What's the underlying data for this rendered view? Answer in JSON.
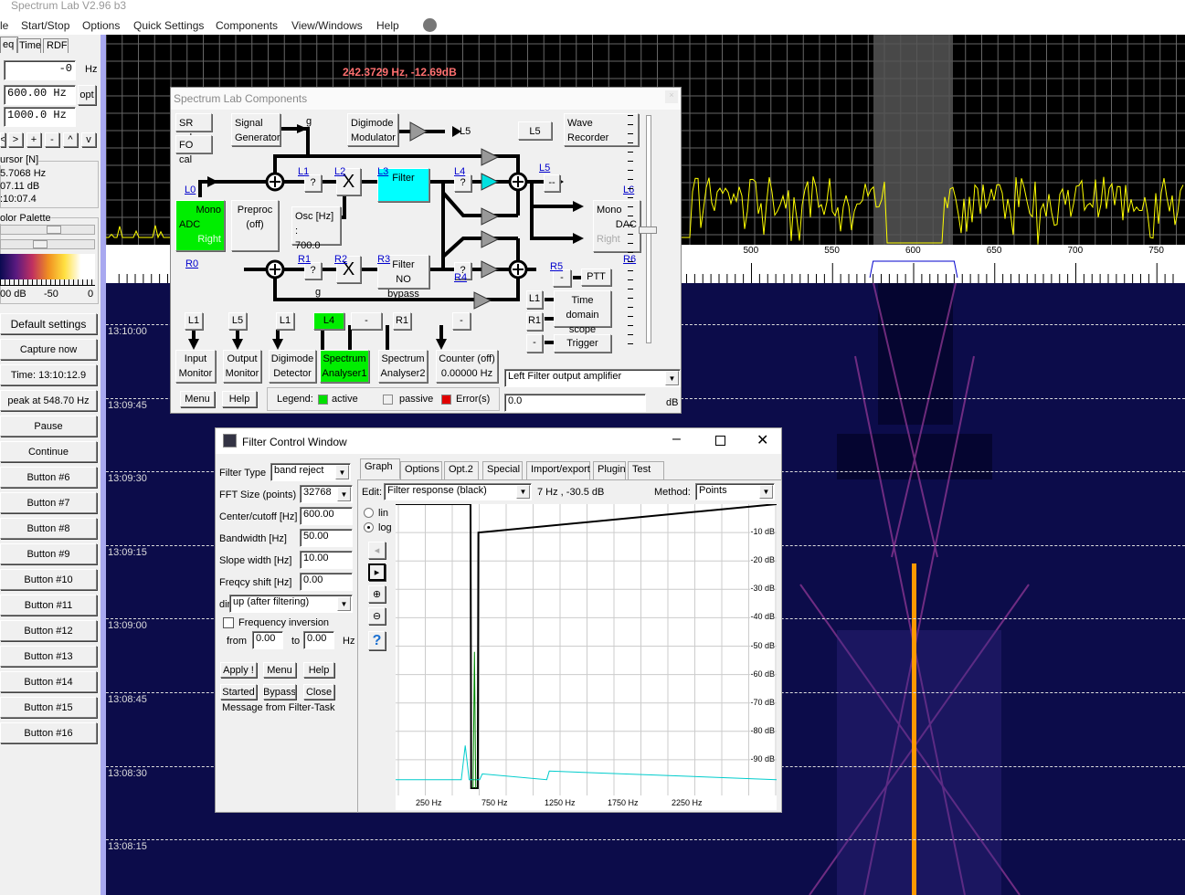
{
  "app": {
    "title": "Spectrum Lab V2.96 b3"
  },
  "menu": [
    "le",
    "Start/Stop",
    "Options",
    "Quick Settings",
    "Components",
    "View/Windows",
    "Help"
  ],
  "left_panel": {
    "tabs": [
      "eq",
      "Time",
      "RDF"
    ],
    "offset_value": "-0",
    "offset_unit": "Hz",
    "center_value": "600.00 Hz",
    "opt_label": "opt",
    "span_value": "1000.0 Hz",
    "nav_buttons": [
      "<",
      ">",
      "+",
      "-",
      "^",
      "v"
    ],
    "cursor_title": "ursor [N]",
    "cursor_freq": "5.7068 Hz",
    "cursor_level": "07.11 dB",
    "cursor_time": ":10:07.4",
    "palette_title": "olor Palette",
    "palette_scale": [
      "00 dB",
      "-50",
      "0"
    ],
    "buttons": [
      "Default settings",
      "Capture now",
      "Time:  13:10:12.9",
      "peak at 548.70 Hz",
      "Pause",
      "Continue",
      "Button #6",
      "Button #7",
      "Button #8",
      "Button #9",
      "Button #10",
      "Button #11",
      "Button #12",
      "Button #13",
      "Button #14",
      "Button #15",
      "Button #16"
    ]
  },
  "spectrum": {
    "readout": "242.3729 Hz, -12.69dB",
    "freq_ticks": [
      "500",
      "550",
      "600",
      "650",
      "700",
      "750"
    ],
    "time_labels": [
      "13:10:00",
      "13:09:45",
      "13:09:30",
      "13:09:15",
      "13:09:00",
      "13:08:45",
      "13:08:30",
      "13:08:15"
    ],
    "colors": {
      "trace": "#ffff00",
      "filter_shade": "#555555",
      "waterfall_bg": "#0c0c4a",
      "carrier": "#ff9900"
    }
  },
  "components": {
    "title": "Spectrum Lab  Components",
    "sr_cal": "SR cal",
    "fo_cal": "FO cal",
    "signal_generator": [
      "Signal",
      "Generator"
    ],
    "digimode_modulator": [
      "Digimode",
      "Modulator"
    ],
    "l5_out": "L5",
    "l5_box": "L5",
    "wave_recorder": "Wave Recorder",
    "g_label": "g",
    "adc": {
      "mono": "Mono",
      "name": "ADC",
      "right": "Right"
    },
    "preproc": [
      "Preproc",
      "(off)"
    ],
    "osc": [
      "Osc [Hz] :",
      "700.0"
    ],
    "q": "?",
    "x": "X",
    "filter_left": "Filter",
    "filter_right": [
      "Filter",
      "NO bypass"
    ],
    "dashes": "--",
    "dac": {
      "mono": "Mono",
      "name": "DAC",
      "right": "Right"
    },
    "ptt": "PTT",
    "dash": "-",
    "scope": [
      "Time domain",
      "scope"
    ],
    "trigger": "Trigger",
    "links": {
      "L0": "L0",
      "L1": "L1",
      "L2": "L2",
      "L3": "L3",
      "L4": "L4",
      "L5": "L5",
      "L6": "L6",
      "R0": "R0",
      "R1": "R1",
      "R2": "R2",
      "R3": "R3",
      "R4": "R4",
      "R5": "R5",
      "R6": "R6"
    },
    "scope_inputs": [
      "L1",
      "R1",
      "-"
    ],
    "sources": [
      "L1",
      "L5",
      "L1",
      "L4",
      "-",
      "R1",
      "-"
    ],
    "bottom": [
      [
        "Input",
        "Monitor"
      ],
      [
        "Output",
        "Monitor"
      ],
      [
        "Digimode",
        "Detector"
      ],
      [
        "Spectrum",
        "Analyser1"
      ],
      [
        "Spectrum",
        "Analyser2"
      ],
      [
        "Counter (off)",
        "0.00000 Hz"
      ]
    ],
    "menu": "Menu",
    "help": "Help",
    "legend": {
      "label": "Legend:",
      "active": "active",
      "passive": "passive",
      "error": "Error(s)"
    },
    "amp_select": "Left Filter output amplifier",
    "gain_value": "0.0",
    "gain_unit": "dB"
  },
  "filter_window": {
    "title": "Filter Control Window",
    "filter_type_label": "Filter Type",
    "filter_type": "band reject",
    "fft_label": "FFT Size (points)",
    "fft": "32768",
    "center_label": "Center/cutoff [Hz]",
    "center": "600.00",
    "bw_label": "Bandwidth [Hz]",
    "bw": "50.00",
    "slope_label": "Slope width [Hz]",
    "slope": "10.00",
    "shift_label": "Freqcy shift [Hz]",
    "shift": "0.00",
    "dir_label": "dir",
    "dir": "up (after filtering)",
    "inversion_label": "Frequency inversion",
    "from_label": "from",
    "from": "0.00",
    "to_label": "to",
    "to": "0.00",
    "hz": "Hz",
    "buttons": [
      "Apply !",
      "Menu",
      "Help",
      "Started",
      "Bypass",
      "Close"
    ],
    "message": "Message from Filter-Task",
    "tabs": [
      "Graph",
      "Options",
      "Opt.2",
      "Special",
      "Import/export",
      "Plugin",
      "Test"
    ],
    "edit_label": "Edit:",
    "edit": "Filter response (black)",
    "cursor_readout": "7  Hz , -30.5 dB",
    "method_label": "Method:",
    "method": "Points",
    "scale_lin": "lin",
    "scale_log": "log",
    "scale_selected": "log"
  },
  "chart_data": {
    "type": "line",
    "xlabel": "",
    "ylabel": "",
    "x_ticks": [
      "250 Hz",
      "750 Hz",
      "1250 Hz",
      "1750 Hz",
      "2250 Hz"
    ],
    "y_ticks": [
      "-10 dB",
      "-20 dB",
      "-30 dB",
      "-40 dB",
      "-50 dB",
      "-60 dB",
      "-70 dB",
      "-80 dB",
      "-90 dB"
    ],
    "ylim": [
      -100,
      0
    ],
    "grid": true,
    "series": [
      {
        "color": "#000000",
        "x": [
          0,
          570,
          575,
          625,
          630,
          2900
        ],
        "y": [
          0,
          0,
          -100,
          -100,
          -10,
          0
        ]
      },
      {
        "color": "#00cccc",
        "x": [
          0,
          500,
          530,
          560,
          640,
          660,
          1150,
          1170,
          2900
        ],
        "y": [
          -97,
          -97,
          -85,
          -97,
          -97,
          -95,
          -97,
          -94,
          -97
        ]
      },
      {
        "color": "#008800",
        "x": [
          590,
          600,
          610
        ],
        "y": [
          -100,
          -52,
          -100
        ]
      }
    ]
  }
}
